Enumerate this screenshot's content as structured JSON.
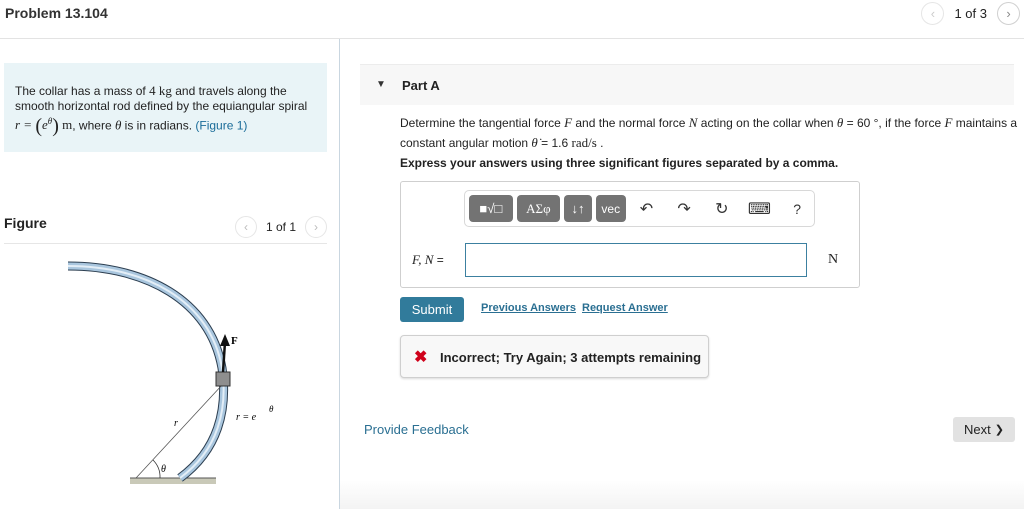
{
  "header": {
    "title": "Problem 13.104",
    "pager": {
      "current": "1 of 3",
      "prev_icon": "‹",
      "next_icon": "›"
    }
  },
  "problem": {
    "text_1": "The collar has a mass of ",
    "mass_value": "4",
    "mass_unit": "kg",
    "text_2": " and travels along the smooth horizontal rod defined by the equiangular spiral ",
    "equation_lhs": "r =",
    "equation_rhs_base": "e",
    "equation_rhs_exp": "θ",
    "equation_unit": "m",
    "text_3": ", where ",
    "theta_symbol": "θ",
    "text_4": " is in radians. ",
    "figure_link": "(Figure 1)"
  },
  "figure": {
    "label": "Figure",
    "pager": "1 of 1",
    "labels": {
      "force": "F",
      "radius": "r",
      "angle": "θ",
      "spiral_eq_lhs": "r = e",
      "spiral_eq_exp": "θ"
    }
  },
  "part": {
    "title": "Part A",
    "question": {
      "t1": "Determine the tangential force ",
      "F": "F",
      "t2": " and the normal force ",
      "N": "N",
      "t3": " acting on the collar when ",
      "theta": "θ",
      "t4": " = 60 °",
      "t5": ", if the force ",
      "F2": "F",
      "t6": " maintains a constant angular motion ",
      "theta_dot": "θ̇",
      "t7": " = 1.6 ",
      "unit": "rad/s",
      "t8": " ."
    },
    "instruction": "Express your answers using three significant figures separated by a comma.",
    "toolbar": {
      "template_btn": "■√□",
      "greek_btn": "ΑΣφ",
      "arrows_btn": "↓↑",
      "vec_btn": "vec",
      "undo_icon": "↶",
      "redo_icon": "↷",
      "reset_icon": "↻",
      "keyboard_icon": "⌨",
      "help_icon": "?"
    },
    "answer": {
      "label_vars": "F, N",
      "label_eq": " =",
      "value": "",
      "placeholder": "",
      "unit": "N"
    },
    "submit_label": "Submit",
    "previous_answers_label": "Previous Answers",
    "request_answer_label": "Request Answer",
    "feedback": {
      "icon": "✖",
      "text": "Incorrect; Try Again; 3 attempts remaining"
    }
  },
  "footer": {
    "provide_feedback": "Provide Feedback",
    "next_label": "Next",
    "next_icon": "❯"
  },
  "colors": {
    "accent": "#317b9b",
    "link": "#2a6f92",
    "statement_bg": "#e9f4f7",
    "error": "#d0021b"
  }
}
